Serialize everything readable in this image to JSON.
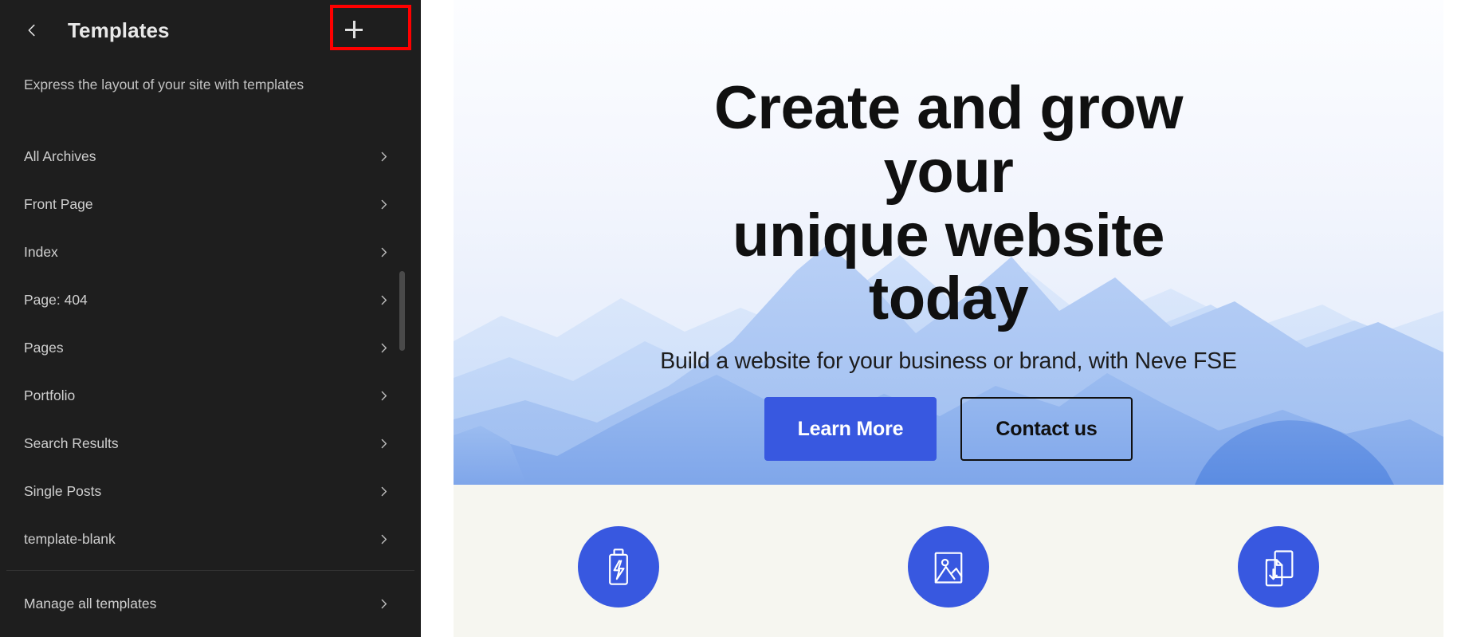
{
  "sidebar": {
    "back_icon": "chevron-left-icon",
    "title": "Templates",
    "add_icon": "plus-icon",
    "description": "Express the layout of your site with templates",
    "items": [
      {
        "label": "All Archives",
        "chevron": "chevron-right-icon"
      },
      {
        "label": "Front Page",
        "chevron": "chevron-right-icon"
      },
      {
        "label": "Index",
        "chevron": "chevron-right-icon"
      },
      {
        "label": "Page: 404",
        "chevron": "chevron-right-icon"
      },
      {
        "label": "Pages",
        "chevron": "chevron-right-icon"
      },
      {
        "label": "Portfolio",
        "chevron": "chevron-right-icon"
      },
      {
        "label": "Search Results",
        "chevron": "chevron-right-icon"
      },
      {
        "label": "Single Posts",
        "chevron": "chevron-right-icon"
      },
      {
        "label": "template-blank",
        "chevron": "chevron-right-icon"
      }
    ],
    "footer_item": {
      "label": "Manage all templates",
      "chevron": "chevron-right-icon"
    },
    "background": "#1e1e1e",
    "text_color": "#cfcfcf"
  },
  "highlight": {
    "color": "#ff0000",
    "target": "add-template-button"
  },
  "preview": {
    "hero": {
      "title_line1": "Create and grow your",
      "title_line2": "unique website today",
      "subtitle": "Build a website for your business or brand, with Neve FSE",
      "primary_button": "Learn More",
      "secondary_button": "Contact us",
      "accent_color": "#3858e0"
    },
    "features": [
      {
        "icon": "battery-charging-icon"
      },
      {
        "icon": "image-icon"
      },
      {
        "icon": "document-download-icon"
      }
    ],
    "section_background": "#f6f6f0"
  }
}
